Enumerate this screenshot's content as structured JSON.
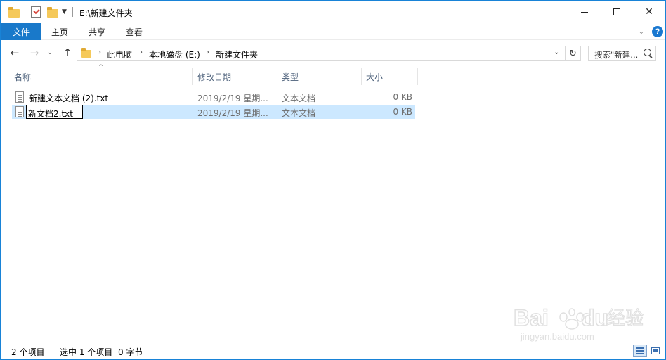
{
  "window": {
    "title": "E:\\新建文件夹"
  },
  "ribbon": {
    "tabs": [
      {
        "label": "文件"
      },
      {
        "label": "主页"
      },
      {
        "label": "共享"
      },
      {
        "label": "查看"
      }
    ],
    "help_label": "?"
  },
  "navigation": {
    "breadcrumb": [
      "此电脑",
      "本地磁盘 (E:)",
      "新建文件夹"
    ],
    "search_placeholder": "搜索\"新建..."
  },
  "columns": [
    "名称",
    "修改日期",
    "类型",
    "大小"
  ],
  "files": [
    {
      "name": "新建文本文档 (2).txt",
      "date": "2019/2/19 星期...",
      "type": "文本文档",
      "size": "0 KB",
      "selected": false
    },
    {
      "name": "新文档2.txt",
      "date": "2019/2/19 星期...",
      "type": "文本文档",
      "size": "0 KB",
      "selected": true,
      "renaming": true
    }
  ],
  "status": {
    "item_count": "2 个项目",
    "selection": "选中 1 个项目",
    "selection_size": "0 字节"
  },
  "watermark": {
    "brand": "Bai du 经验",
    "url": "jingyan.baidu.com"
  },
  "colors": {
    "accent": "#1979ca",
    "selection": "#cce8ff",
    "border": "#1883d7"
  }
}
